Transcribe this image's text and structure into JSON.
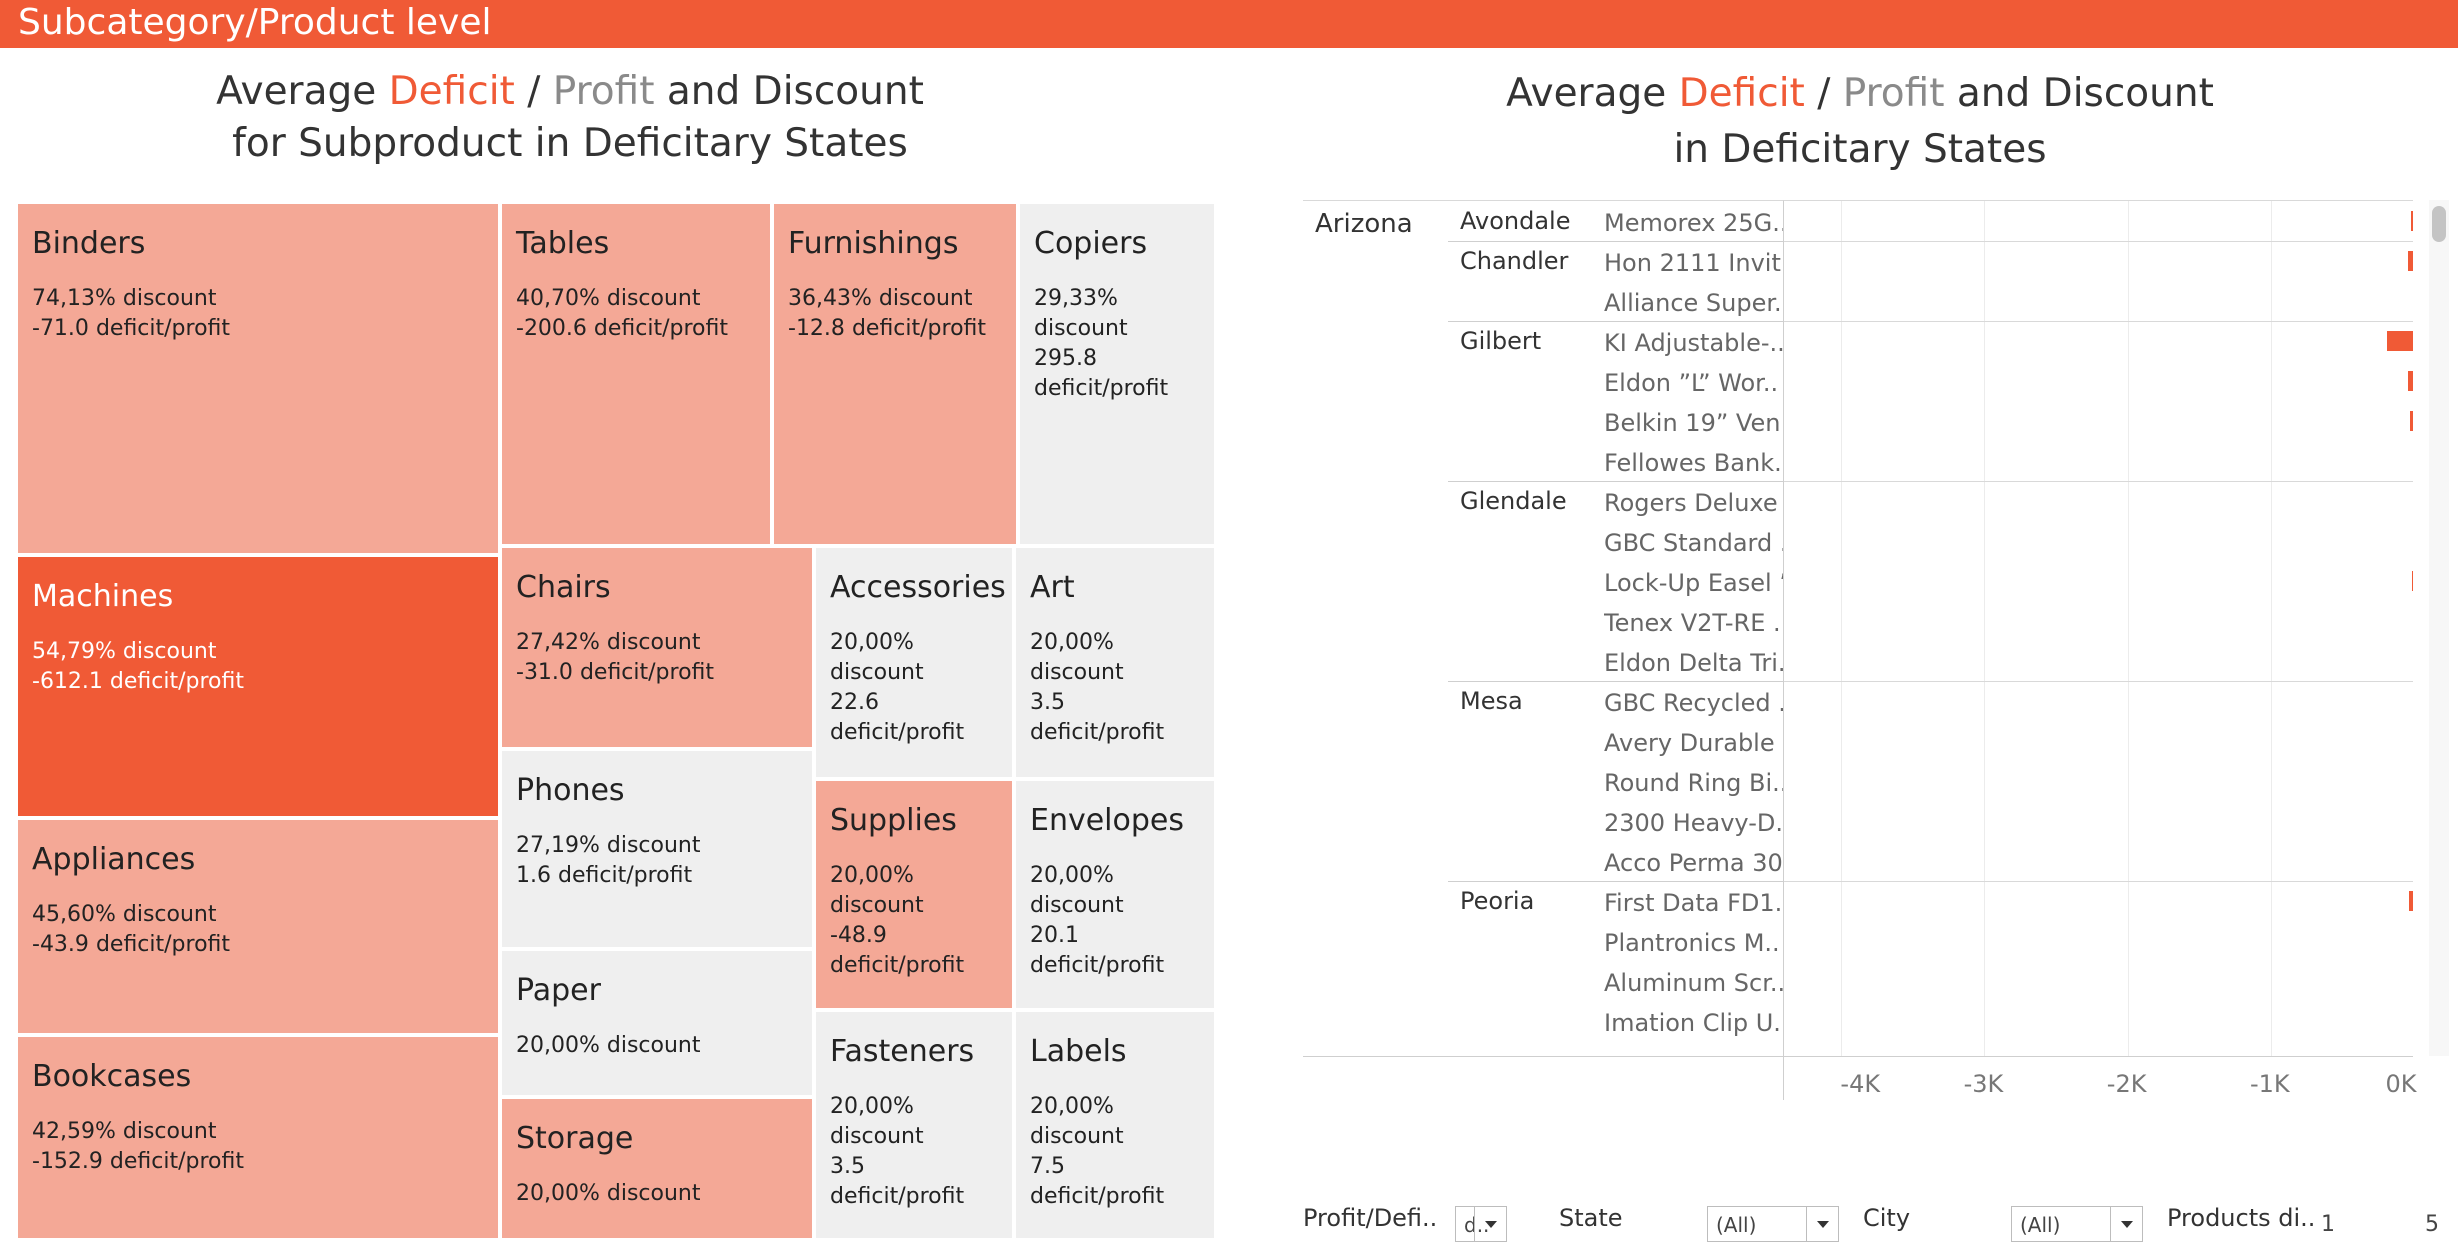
{
  "header": {
    "title": "Subcategory/Product level"
  },
  "left_title": {
    "line1_prefix": "Average ",
    "deficit": "Deficit",
    "slash": " / ",
    "profit": "Profit",
    "line1_suffix": " and Discount",
    "line2": "for Subproduct in Deficitary States"
  },
  "right_title": {
    "line1_prefix": "Average ",
    "deficit": "Deficit",
    "slash": " / ",
    "profit": "Profit",
    "line1_suffix": " and Discount",
    "line2": "in Deficitary States"
  },
  "colors": {
    "accent": "#f05a36",
    "mid": "#f4a896",
    "grey": "#efefef"
  },
  "treemap": [
    {
      "name": "Binders",
      "discount": "74,13%",
      "discount_label": "discount",
      "value": "-71.0",
      "value_label": "deficit/profit"
    },
    {
      "name": "Tables",
      "discount": "40,70%",
      "discount_label": "discount",
      "value": "-200.6",
      "value_label": "deficit/profit"
    },
    {
      "name": "Furnishings",
      "discount": "36,43%",
      "discount_label": "discount",
      "value": "-12.8",
      "value_label": "deficit/profit"
    },
    {
      "name": "Copiers",
      "discount": "29,33%",
      "discount_label": "discount",
      "value": "295.8",
      "value_label": "deficit/profit"
    },
    {
      "name": "Machines",
      "discount": "54,79%",
      "discount_label": "discount",
      "value": "-612.1",
      "value_label": "deficit/profit"
    },
    {
      "name": "Chairs",
      "discount": "27,42%",
      "discount_label": "discount",
      "value": "-31.0",
      "value_label": "deficit/profit"
    },
    {
      "name": "Accessories",
      "discount": "20,00%",
      "discount_label": "discount",
      "value": "22.6",
      "value_label": "deficit/profit"
    },
    {
      "name": "Art",
      "discount": "20,00%",
      "discount_label": "discount",
      "value": "3.5",
      "value_label": "deficit/profit"
    },
    {
      "name": "Phones",
      "discount": "27,19%",
      "discount_label": "discount",
      "value": "1.6",
      "value_label": "deficit/profit"
    },
    {
      "name": "Appliances",
      "discount": "45,60%",
      "discount_label": "discount",
      "value": "-43.9",
      "value_label": "deficit/profit"
    },
    {
      "name": "Supplies",
      "discount": "20,00%",
      "discount_label": "discount",
      "value": "-48.9",
      "value_label": "deficit/profit"
    },
    {
      "name": "Envelopes",
      "discount": "20,00%",
      "discount_label": "discount",
      "value": "20.1",
      "value_label": "deficit/profit"
    },
    {
      "name": "Paper",
      "discount": "20,00%",
      "discount_label": "discount"
    },
    {
      "name": "Bookcases",
      "discount": "42,59%",
      "discount_label": "discount",
      "value": "-152.9",
      "value_label": "deficit/profit"
    },
    {
      "name": "Storage",
      "discount": "20,00%",
      "discount_label": "discount"
    },
    {
      "name": "Fasteners",
      "discount": "20,00%",
      "discount_label": "discount",
      "value": "3.5",
      "value_label": "deficit/profit"
    },
    {
      "name": "Labels",
      "discount": "20,00%",
      "discount_label": "discount",
      "value": "7.5",
      "value_label": "deficit/profit"
    }
  ],
  "chart_data": {
    "type": "bar",
    "orientation": "horizontal",
    "state": "Arizona",
    "cities": [
      "Avondale",
      "Chandler",
      "Gilbert",
      "Glendale",
      "Mesa",
      "Peoria"
    ],
    "rows": [
      {
        "city": "Avondale",
        "product": "Memorex 25G..",
        "value": -20
      },
      {
        "city": "Chandler",
        "product": "Hon 2111 Invit..",
        "value": -45
      },
      {
        "city": "Chandler",
        "product": "Alliance Super..",
        "value": -10
      },
      {
        "city": "Gilbert",
        "product": "KI Adjustable-..",
        "value": -190
      },
      {
        "city": "Gilbert",
        "product": "Eldon ”L” Wor..",
        "value": -40
      },
      {
        "city": "Gilbert",
        "product": "Belkin 19” Ven..",
        "value": -25
      },
      {
        "city": "Gilbert",
        "product": "Fellowes Bank..",
        "value": -5
      },
      {
        "city": "Glendale",
        "product": "Rogers Deluxe ..",
        "value": -8
      },
      {
        "city": "Glendale",
        "product": "GBC Standard ..",
        "value": -10
      },
      {
        "city": "Glendale",
        "product": "Lock-Up Easel ’..",
        "value": -12
      },
      {
        "city": "Glendale",
        "product": "Tenex V2T-RE ..",
        "value": -5
      },
      {
        "city": "Glendale",
        "product": "Eldon Delta Tri..",
        "value": -4
      },
      {
        "city": "Mesa",
        "product": "GBC Recycled ..",
        "value": -8
      },
      {
        "city": "Mesa",
        "product": "Avery Durable ..",
        "value": -3
      },
      {
        "city": "Mesa",
        "product": "Round Ring Bi..",
        "value": -3
      },
      {
        "city": "Mesa",
        "product": "2300 Heavy-D..",
        "value": -3
      },
      {
        "city": "Mesa",
        "product": "Acco Perma 30..",
        "value": -3
      },
      {
        "city": "Peoria",
        "product": "First Data FD1..",
        "value": -35
      },
      {
        "city": "Peoria",
        "product": "Plantronics M..",
        "value": -5
      },
      {
        "city": "Peoria",
        "product": "Aluminum Scr..",
        "value": -3
      },
      {
        "city": "Peoria",
        "product": "Imation Clip U..",
        "value": -3
      }
    ],
    "xlim": [
      -4400,
      0
    ],
    "xticks": [
      -4000,
      -3000,
      -2000,
      -1000,
      0
    ],
    "xtick_labels": [
      "-4K",
      "-3K",
      "-2K",
      "-1K",
      "0K"
    ],
    "bar_color": "#f05a36",
    "grid": true
  },
  "filters": {
    "profit_label": "Profit/Defi..",
    "profit_value": "d..",
    "state_label": "State",
    "state_value": "(All)",
    "city_label": "City",
    "city_value": "(All)",
    "products_label": "Products di..",
    "range_min": "1",
    "range_max": "5"
  }
}
